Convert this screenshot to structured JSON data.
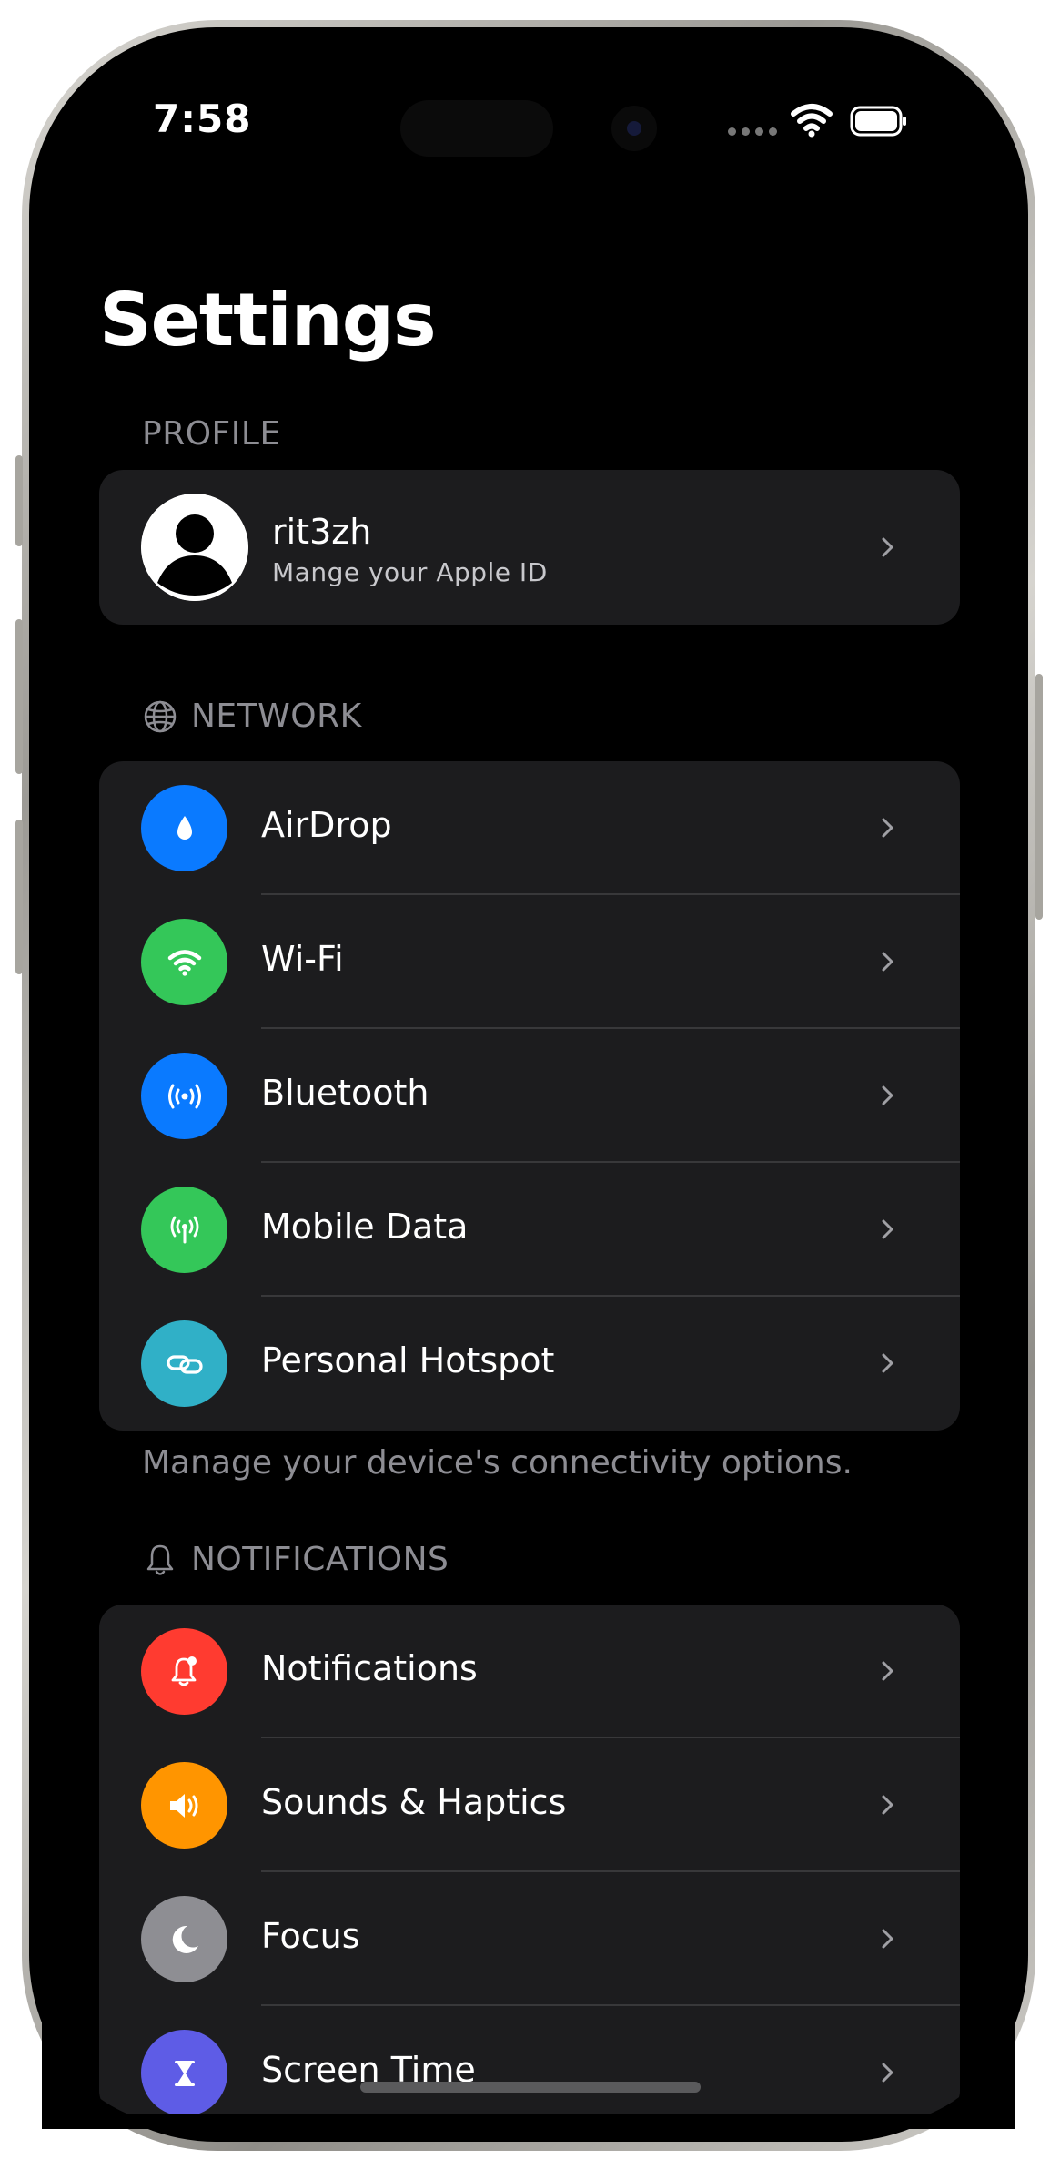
{
  "status_bar": {
    "time": "7:58"
  },
  "page": {
    "title": "Settings"
  },
  "profile_section": {
    "header": "PROFILE",
    "name": "rit3zh",
    "subtitle": "Mange your Apple ID"
  },
  "network_section": {
    "header": "NETWORK",
    "items": [
      {
        "label": "AirDrop",
        "icon": "airdrop-drop-icon",
        "color": "#0a7aff"
      },
      {
        "label": "Wi-Fi",
        "icon": "wifi-icon",
        "color": "#34c759"
      },
      {
        "label": "Bluetooth",
        "icon": "bluetooth-waves-icon",
        "color": "#0a7aff"
      },
      {
        "label": "Mobile Data",
        "icon": "antenna-icon",
        "color": "#34c759"
      },
      {
        "label": "Personal Hotspot",
        "icon": "link-icon",
        "color": "#30b0c7"
      }
    ],
    "footer": "Manage your device's connectivity options."
  },
  "notifications_section": {
    "header": "NOTIFICATIONS",
    "items": [
      {
        "label": "Notifications",
        "icon": "bell-badge-icon",
        "color": "#ff3b30"
      },
      {
        "label": "Sounds & Haptics",
        "icon": "speaker-icon",
        "color": "#ff9500"
      },
      {
        "label": "Focus",
        "icon": "moon-icon",
        "color": "#8e8e93"
      },
      {
        "label": "Screen Time",
        "icon": "hourglass-icon",
        "color": "#5e5ce6"
      }
    ]
  }
}
